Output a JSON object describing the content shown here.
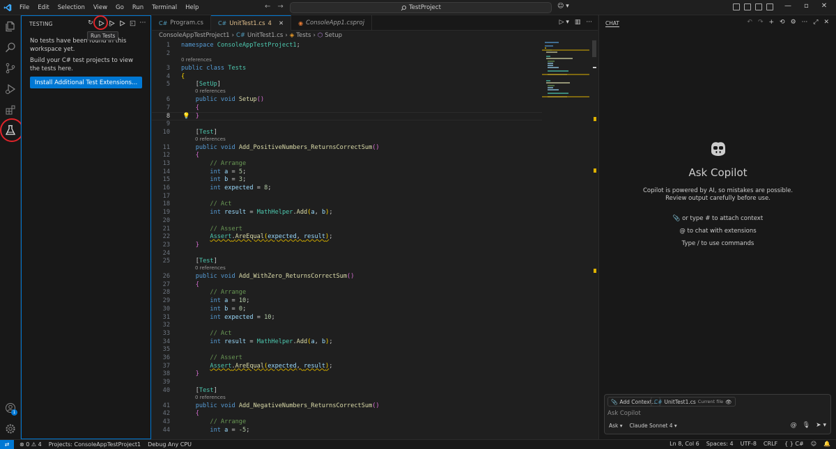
{
  "menu": [
    "File",
    "Edit",
    "Selection",
    "View",
    "Go",
    "Run",
    "Terminal",
    "Help"
  ],
  "search": {
    "text": "TestProject"
  },
  "testing": {
    "title": "TESTING",
    "tooltip": "Run Tests",
    "message": "No tests have been found in this workspace yet.",
    "message2": "Build your C# test projects to view the tests here.",
    "button": "Install Additional Test Extensions..."
  },
  "tabs": [
    {
      "label": "Program.cs",
      "badge": ""
    },
    {
      "label": "UnitTest1.cs",
      "badge": "4"
    },
    {
      "label": "ConsoleApp1.csproj",
      "badge": ""
    }
  ],
  "breadcrumbs": [
    "ConsoleAppTestProject1",
    "UnitTest1.cs",
    "Tests",
    "Setup"
  ],
  "codelens": "0 references",
  "chat": {
    "title": "CHAT",
    "heading": "Ask Copilot",
    "description": "Copilot is powered by AI, so mistakes are possible. Review output carefully before use.",
    "hint1": "or type # to attach context",
    "hint2": "to chat with extensions",
    "hint3": "Type / to use commands",
    "add_context": "Add Context...",
    "file_chip": "UnitTest1.cs",
    "file_chip_note": "Current file",
    "placeholder": "Ask Copilot",
    "mode": "Ask",
    "model": "Claude Sonnet 4"
  },
  "status": {
    "errors": "0",
    "warnings": "4",
    "project": "Projects: ConsoleAppTestProject1",
    "config": "Debug Any CPU",
    "position": "Ln 8, Col 6",
    "spaces": "Spaces: 4",
    "encoding": "UTF-8",
    "eol": "CRLF",
    "language": "C#"
  },
  "account_badge": "1",
  "accent": "#0078d4",
  "highlight_color": "#e0242a"
}
